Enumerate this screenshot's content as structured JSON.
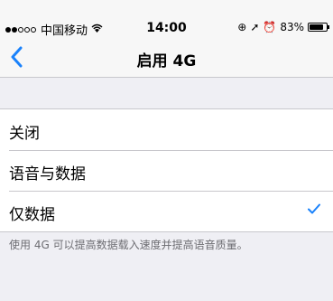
{
  "status_bar": {
    "carrier": "中国移动",
    "time": "14:00",
    "battery": "83%",
    "battery_level": 0.83,
    "signal_full_dots": 2,
    "signal_total_dots": 5
  },
  "nav": {
    "back_icon": "chevron-left-icon",
    "title": "启用 4G"
  },
  "options": [
    {
      "label": "关闭",
      "selected": false
    },
    {
      "label": "语音与数据",
      "selected": false
    },
    {
      "label": "仅数据",
      "selected": true
    }
  ],
  "footer_text": "使用 4G 可以提高数据载入速度并提高语音质量。",
  "colors": {
    "accent": "#1a82fb",
    "background": "#efeff4",
    "separator": "#c8c7cc"
  }
}
